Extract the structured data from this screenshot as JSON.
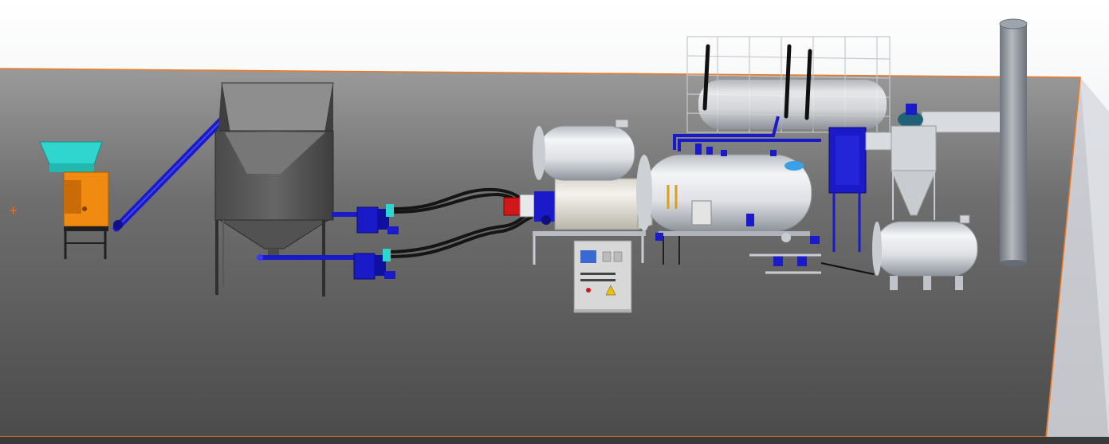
{
  "scene": {
    "kind": "3D CAD model render — biomass fired steam boiler plant layout",
    "visible_text": []
  },
  "colors": {
    "background_top": "#ffffff",
    "background_bottom": "#cfd3d9",
    "floor_light": "#7d7d7d",
    "floor_dark": "#444444",
    "outline": "#f07820",
    "shredder_hopper": "#2fd6d0",
    "shredder_body": "#f08a10",
    "steel_dark": "#505050",
    "conveyor_blue": "#1a1ac8",
    "vessel_light": "#e6e8ec",
    "vessel_shade": "#9aa0a8",
    "burner_red": "#d01818",
    "panel_grey": "#d8d8d8",
    "chimney": "#8a9098",
    "cyclone_teal": "#206078"
  },
  "components": [
    {
      "id": "shredder",
      "icon": "shredder-icon"
    },
    {
      "id": "inclined-screw-conveyor",
      "icon": "screw-conveyor-icon"
    },
    {
      "id": "storage-silo",
      "icon": "silo-icon"
    },
    {
      "id": "feeder-screw-1",
      "icon": "feeder-icon"
    },
    {
      "id": "feeder-screw-2",
      "icon": "feeder-icon"
    },
    {
      "id": "feed-hoses",
      "icon": "hose-icon"
    },
    {
      "id": "burner-furnace",
      "icon": "burner-icon"
    },
    {
      "id": "control-panel",
      "icon": "control-panel-icon"
    },
    {
      "id": "feedwater-tank",
      "icon": "tank-icon"
    },
    {
      "id": "steam-boiler",
      "icon": "boiler-icon"
    },
    {
      "id": "platform-railing",
      "icon": "railing-icon"
    },
    {
      "id": "economizer",
      "icon": "economizer-icon"
    },
    {
      "id": "cyclone-separator",
      "icon": "cyclone-icon"
    },
    {
      "id": "flue-chimney",
      "icon": "chimney-icon"
    },
    {
      "id": "condensate-tank",
      "icon": "tank-icon"
    },
    {
      "id": "origin-marker",
      "icon": "plus-icon"
    }
  ]
}
